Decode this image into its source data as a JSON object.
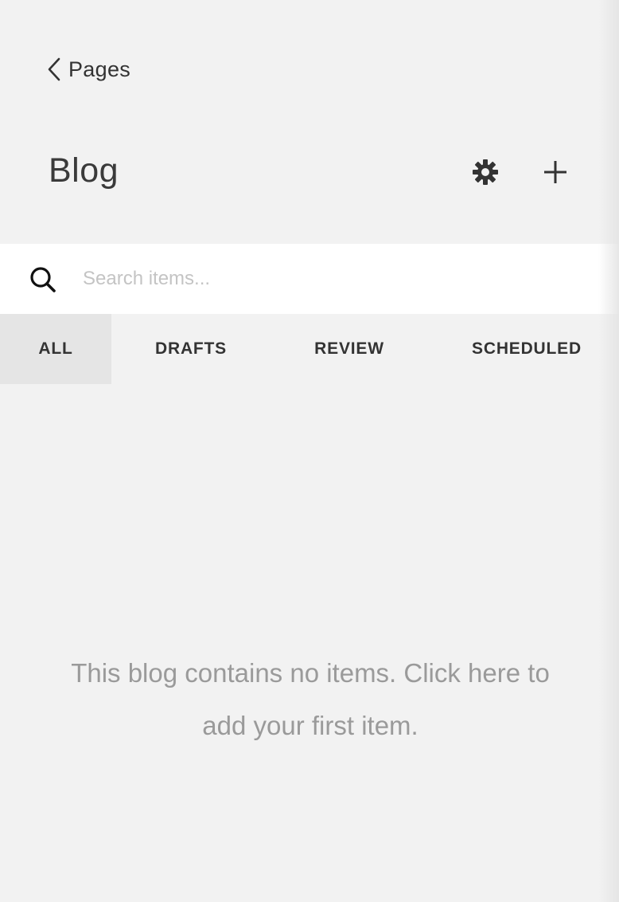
{
  "nav": {
    "back_label": "Pages"
  },
  "header": {
    "title": "Blog"
  },
  "search": {
    "placeholder": "Search items..."
  },
  "tabs": [
    {
      "label": "ALL",
      "active": true
    },
    {
      "label": "DRAFTS",
      "active": false
    },
    {
      "label": "REVIEW",
      "active": false
    },
    {
      "label": "SCHEDULED",
      "active": false
    }
  ],
  "empty_state": {
    "message": "This blog contains no items. Click here to add your first item."
  },
  "icons": {
    "back": "chevron-left-icon",
    "settings": "gear-icon",
    "add": "plus-icon",
    "search": "search-icon"
  },
  "colors": {
    "background": "#f2f2f2",
    "search_background": "#ffffff",
    "active_tab": "#e5e5e5",
    "text": "#3a3a3a",
    "muted_text": "#9a9a9a",
    "placeholder": "#c4c4c4"
  }
}
